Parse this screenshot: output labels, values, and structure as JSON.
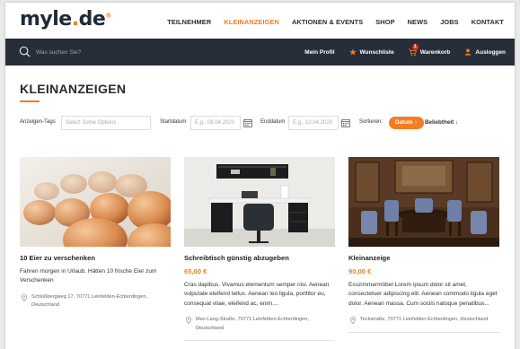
{
  "header": {
    "logo_text": "myle",
    "logo_dot": ".",
    "logo_tld": "de",
    "logo_mark": "®",
    "nav": [
      {
        "label": "TEILNEHMER",
        "active": false
      },
      {
        "label": "KLEINANZEIGEN",
        "active": true
      },
      {
        "label": "AKTIONEN & EVENTS",
        "active": false
      },
      {
        "label": "SHOP",
        "active": false
      },
      {
        "label": "NEWS",
        "active": false
      },
      {
        "label": "JOBS",
        "active": false
      },
      {
        "label": "KONTAKT",
        "active": false
      }
    ]
  },
  "searchbar": {
    "placeholder": "Was suchen Sie?",
    "my_profile": "Mein Profil",
    "wishlist": "Wunschliste",
    "cart": "Warenkorb",
    "cart_count": "1",
    "logout": "Ausloggen"
  },
  "page": {
    "title": "KLEINANZEIGEN"
  },
  "filters": {
    "tags_label": "Anzeigen-Tags",
    "tags_placeholder": "Select Some Options",
    "start_label": "Startdatum",
    "start_placeholder": "E.g., 08.04.2020",
    "end_label": "Enddatum",
    "end_placeholder": "E.g., 10.04.2020",
    "sort_label": "Sortieren:",
    "sort_date": "Datum ↑",
    "sort_popularity": "Beliebtheit ↓"
  },
  "listings": [
    {
      "title": "10 Eier zu verschenken",
      "price": "",
      "description": "Fahren morgen in Urlaub. Hätten 10 frische Eier zum Verschenken",
      "address_line1": "Schloßbergweg 17, 70771 Leinfelden-Echterdingen,",
      "address_line2": "Deutschland"
    },
    {
      "title": "Schreibtisch günstig abzugeben",
      "price": "65,00 €",
      "description": "Cras dapibus. Vivamus elementum semper nisi. Aenean vulputate eleifend tellus. Aenean leo ligula, porttitor eu, consequat vitae, eleifend ac, enim....",
      "address_line1": "Max-Lang-Straße, 70771 Leinfelden-Echterdingen,",
      "address_line2": "Deutschland"
    },
    {
      "title": "Kleinanzeige",
      "price": "90,00 €",
      "description": "Esszimmermöbel Lorem ipsum dolor sit amet, consectetuer adipiscing elit. Aenean commodo ligula eget dolor. Aenean massa. Cum sociis natoque penatibus...",
      "address_line1": "Teckstraße, 70771 Leinfelden-Echterdingen, Deutschland",
      "address_line2": ""
    }
  ],
  "colors": {
    "accent": "#f47c20",
    "dark_bar": "#272e39",
    "badge": "#e52b2b"
  },
  "icons": {
    "search": "search-icon",
    "wishlist": "star-icon",
    "cart": "cart-icon",
    "logout": "user-icon",
    "calendar": "calendar-icon",
    "location": "map-pin-icon"
  }
}
